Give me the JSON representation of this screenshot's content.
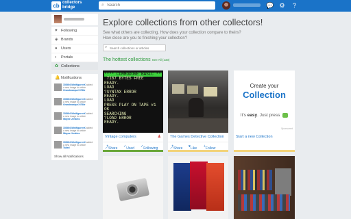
{
  "header": {
    "logo_mark": "cb",
    "logo_line1": "collectors",
    "logo_line2": "bridge",
    "search_placeholder": "Search"
  },
  "sidebar": {
    "items": [
      {
        "label": "Following",
        "icon": "user-plus-icon"
      },
      {
        "label": "Brands",
        "icon": "tag-icon"
      },
      {
        "label": "Users",
        "icon": "users-icon"
      },
      {
        "label": "Portals",
        "icon": "portal-icon"
      },
      {
        "label": "Collections",
        "icon": "collections-icon",
        "active": true
      }
    ],
    "notifications_label": "Notifications",
    "notifications": [
      {
        "a": "155494 MinifigurenX",
        "b": "added",
        "c": "a new image to article",
        "d": "GrandmarqueX Ellie"
      },
      {
        "a": "155494 MinifigurenX",
        "b": "added",
        "c": "a new image to article",
        "d": "GrandmarqueX Ellie"
      },
      {
        "a": "155494 MinifigurenX",
        "b": "added",
        "c": "a new image to article",
        "d": "Wayne Jenkins"
      },
      {
        "a": "155494 MinifigurenX",
        "b": "added",
        "c": "a new image to article",
        "d": "Wayne Jenkins"
      },
      {
        "a": "155494 MinifigurenX",
        "b": "added",
        "c": "a new image to article",
        "d": "Tailed"
      }
    ],
    "show_all": "Show all Notifications"
  },
  "main": {
    "title": "Explore collections from other collectors!",
    "sub1": "See what others are collecting.  How does your collection compare to theirs?",
    "sub2": "How close are you to finishing your collection?",
    "search_placeholder": "Search collections or articles",
    "hottest_label": "The hottest collections",
    "see_all": "See All (133)"
  },
  "cards": {
    "c1": {
      "title": "Vintage computers",
      "share": "Share",
      "used": "Used",
      "following": "Following",
      "terminal": [
        "**** COMMODORE BASIC ****",
        " 7167 BYTES FREE",
        "READY.",
        "LOAD",
        "?SYNTAX ERROR",
        "READY.",
        "LOAD",
        "",
        "PRESS PLAY ON TAPE #1",
        "OK",
        "",
        "SEARCHING",
        "?LOAD ERROR",
        "READY."
      ]
    },
    "c2": {
      "title": "The Games Detective Collection",
      "share": "Share",
      "like": "Like",
      "follow": "Follow"
    },
    "c3": {
      "ad_title": "Create your",
      "ad_big": "Collection",
      "ad_pre": "It's ",
      "ad_bold": "easy",
      "ad_post": ". Just press",
      "sponsored": "Sponsored",
      "title": "Start a new Collection"
    }
  },
  "colors": {
    "brand_blue": "#1a73c8",
    "accent_green": "#2e9b3c",
    "card_bar_green": "#6aa73a",
    "card_bar_gold": "#f3d37a"
  }
}
